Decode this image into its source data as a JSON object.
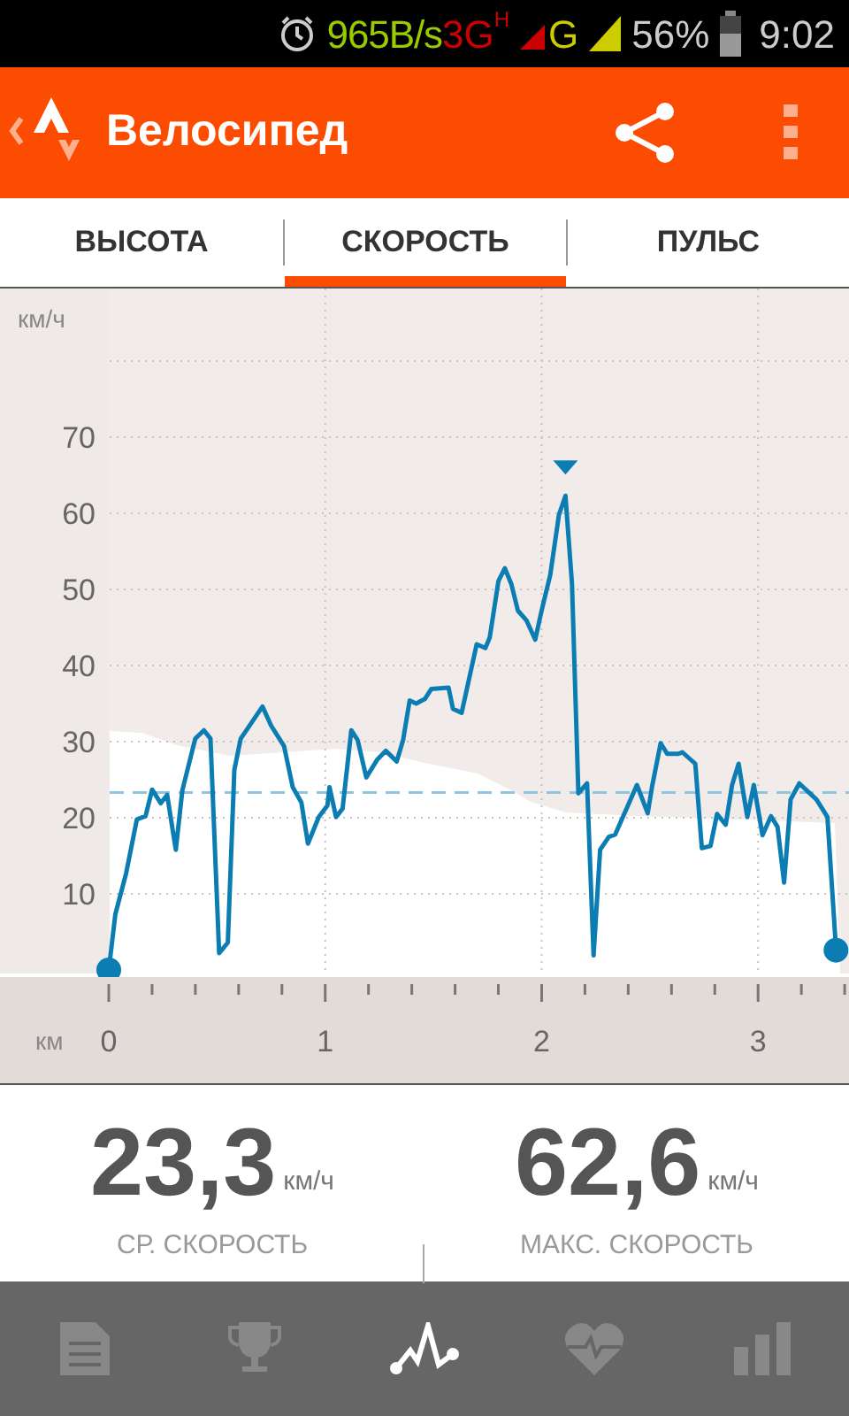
{
  "status_bar": {
    "speed": "965B/s",
    "network": "3G",
    "network_sub": "H",
    "network2": "G",
    "battery": "56%",
    "time": "9:02"
  },
  "app_bar": {
    "title": "Велосипед"
  },
  "tabs": [
    {
      "label": "ВЫСОТА",
      "selected": false
    },
    {
      "label": "СКОРОСТЬ",
      "selected": true
    },
    {
      "label": "ПУЛЬС",
      "selected": false
    }
  ],
  "chart": {
    "chart_data": {
      "type": "line",
      "xlabel": "км",
      "ylabel": "км/ч",
      "xlim": [
        0,
        3.42
      ],
      "ylim": [
        0,
        80
      ],
      "xticks": [
        0,
        1,
        2,
        3
      ],
      "yticks": [
        10,
        20,
        30,
        40,
        50,
        60,
        70
      ],
      "grid": true,
      "ref_lines": [
        {
          "axis": "y",
          "value": 23.3
        }
      ],
      "x": [
        0,
        0.03,
        0.08,
        0.13,
        0.17,
        0.2,
        0.24,
        0.27,
        0.31,
        0.34,
        0.4,
        0.44,
        0.47,
        0.51,
        0.55,
        0.58,
        0.61,
        0.71,
        0.75,
        0.81,
        0.85,
        0.89,
        0.92,
        0.97,
        1.01,
        1.02,
        1.05,
        1.08,
        1.12,
        1.15,
        1.19,
        1.24,
        1.28,
        1.33,
        1.36,
        1.39,
        1.42,
        1.46,
        1.49,
        1.57,
        1.59,
        1.63,
        1.66,
        1.7,
        1.74,
        1.76,
        1.8,
        1.83,
        1.86,
        1.89,
        1.93,
        1.97,
        2,
        2.04,
        2.08,
        2.11,
        2.14,
        2.17,
        2.21,
        2.24,
        2.27,
        2.31,
        2.34,
        2.44,
        2.49,
        2.51,
        2.55,
        2.58,
        2.63,
        2.65,
        2.71,
        2.74,
        2.78,
        2.81,
        2.85,
        2.88,
        2.91,
        2.95,
        2.98,
        3.02,
        3.06,
        3.09,
        3.12,
        3.15,
        3.19,
        3.27,
        3.32,
        3.36
      ],
      "series": [
        {
          "color": "#0b7db3",
          "values": [
            0,
            7.3,
            12.7,
            19.8,
            20.2,
            23.7,
            21.9,
            23,
            15.8,
            23.6,
            30.4,
            31.5,
            30.4,
            2.2,
            3.6,
            26.3,
            30.4,
            34.6,
            32.1,
            29.4,
            24,
            22,
            16.6,
            20.1,
            21.6,
            24,
            20.1,
            21.2,
            31.5,
            30.2,
            25.3,
            27.6,
            28.8,
            27.4,
            30.2,
            35.4,
            35,
            35.6,
            36.9,
            37.1,
            34.3,
            33.8,
            37.6,
            42.8,
            42.3,
            43.7,
            51.1,
            52.8,
            50.7,
            47.2,
            45.9,
            43.4,
            47.2,
            51.9,
            59.8,
            62.3,
            50.7,
            23.2,
            24.5,
            1.9,
            15.8,
            17.5,
            17.8,
            24.3,
            20.6,
            24,
            29.8,
            28.4,
            28.4,
            28.6,
            27.1,
            16,
            16.3,
            20.5,
            19.1,
            24.3,
            27.1,
            20.1,
            24.3,
            17.7,
            20.2,
            18.8,
            11.5,
            22.4,
            24.5,
            22.4,
            20.1,
            2.6
          ]
        }
      ]
    }
  },
  "stats": [
    {
      "value": "23,3",
      "unit": "км/ч",
      "label": "СР. СКОРОСТЬ"
    },
    {
      "value": "62,6",
      "unit": "км/ч",
      "label": "МАКС. СКОРОСТЬ"
    }
  ],
  "bottom_nav": [
    {
      "selected": false
    },
    {
      "selected": false
    },
    {
      "selected": true
    },
    {
      "selected": false
    },
    {
      "selected": false
    }
  ]
}
